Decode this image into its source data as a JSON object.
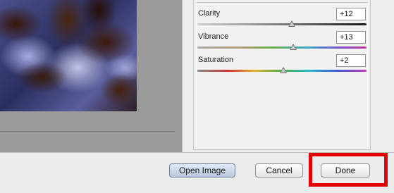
{
  "adjustments": [
    {
      "label": "Clarity",
      "value": "+12",
      "level": 0.56
    },
    {
      "label": "Vibrance",
      "value": "+13",
      "level": 0.565
    },
    {
      "label": "Saturation",
      "value": "+2",
      "level": 0.51
    }
  ],
  "buttons": {
    "open_image": "Open Image",
    "cancel": "Cancel",
    "done": "Done"
  },
  "colors": {
    "highlight": "#e20000",
    "primary_button": "#b9c8de"
  }
}
